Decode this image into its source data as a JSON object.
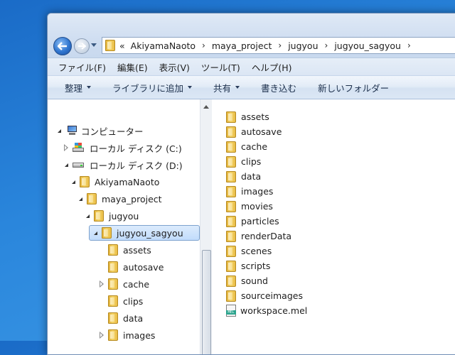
{
  "window": {
    "breadcrumb": {
      "overflow": "«",
      "items": [
        "AkiyamaNaoto",
        "maya_project",
        "jugyou",
        "jugyou_sagyou"
      ],
      "separator": "›"
    },
    "menu": [
      "ファイル(F)",
      "編集(E)",
      "表示(V)",
      "ツール(T)",
      "ヘルプ(H)"
    ],
    "toolbar": {
      "organize": "整理",
      "add_to_library": "ライブラリに追加",
      "share": "共有",
      "burn": "書き込む",
      "new_folder": "新しいフォルダー"
    }
  },
  "nav_tree": [
    {
      "label": "コンピューター",
      "icon": "computer-icon",
      "level": 0,
      "state": "open"
    },
    {
      "label": "ローカル ディスク (C:)",
      "icon": "windows-drive-icon",
      "level": 1,
      "state": "closed"
    },
    {
      "label": "ローカル ディスク (D:)",
      "icon": "drive-icon",
      "level": 1,
      "state": "open"
    },
    {
      "label": "AkiyamaNaoto",
      "icon": "folder-icon",
      "level": 2,
      "state": "open"
    },
    {
      "label": "maya_project",
      "icon": "folder-icon",
      "level": 3,
      "state": "open"
    },
    {
      "label": "jugyou",
      "icon": "folder-icon",
      "level": 4,
      "state": "open"
    },
    {
      "label": "jugyou_sagyou",
      "icon": "folder-icon",
      "level": 5,
      "state": "open",
      "selected": true
    },
    {
      "label": "assets",
      "icon": "folder-icon",
      "level": 6,
      "state": "none"
    },
    {
      "label": "autosave",
      "icon": "folder-icon",
      "level": 6,
      "state": "none"
    },
    {
      "label": "cache",
      "icon": "folder-icon",
      "level": 6,
      "state": "closed"
    },
    {
      "label": "clips",
      "icon": "folder-icon",
      "level": 6,
      "state": "none"
    },
    {
      "label": "data",
      "icon": "folder-icon",
      "level": 6,
      "state": "none"
    },
    {
      "label": "images",
      "icon": "folder-icon",
      "level": 6,
      "state": "closed"
    }
  ],
  "files": [
    {
      "name": "assets",
      "type": "folder"
    },
    {
      "name": "autosave",
      "type": "folder"
    },
    {
      "name": "cache",
      "type": "folder"
    },
    {
      "name": "clips",
      "type": "folder"
    },
    {
      "name": "data",
      "type": "folder"
    },
    {
      "name": "images",
      "type": "folder"
    },
    {
      "name": "movies",
      "type": "folder"
    },
    {
      "name": "particles",
      "type": "folder"
    },
    {
      "name": "renderData",
      "type": "folder"
    },
    {
      "name": "scenes",
      "type": "folder"
    },
    {
      "name": "scripts",
      "type": "folder"
    },
    {
      "name": "sound",
      "type": "folder"
    },
    {
      "name": "sourceimages",
      "type": "folder"
    },
    {
      "name": "workspace.mel",
      "type": "mel",
      "icon_text": "MEL"
    }
  ]
}
